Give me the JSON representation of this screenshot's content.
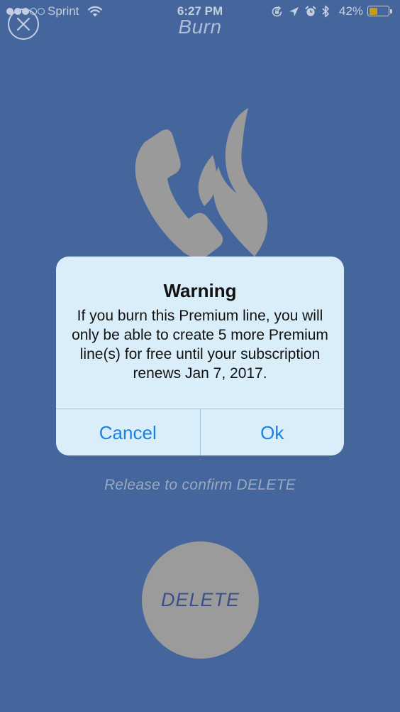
{
  "status_bar": {
    "signal_bars_filled": 3,
    "signal_bars_total": 5,
    "carrier": "Sprint",
    "time": "6:27 PM",
    "battery_percent": "42%",
    "battery_level": 0.42,
    "battery_color": "#c79c12",
    "icons": [
      "wifi-icon",
      "orientation-lock-icon",
      "location-icon",
      "alarm-icon",
      "bluetooth-icon"
    ]
  },
  "header": {
    "title": "Burn",
    "close_icon": "close-icon"
  },
  "illustration": {
    "icon": "burn-phone-flame-icon"
  },
  "alert": {
    "title": "Warning",
    "message": "If you burn this Premium line, you will only be able to create 5 more Premium line(s) for free until your subscription renews Jan 7, 2017.",
    "cancel_label": "Cancel",
    "ok_label": "Ok",
    "button_color": "#1a7fe6"
  },
  "footer": {
    "hint": "Release to confirm DELETE",
    "delete_label": "DELETE"
  },
  "colors": {
    "background": "#44669c",
    "alert_background": "#d9eef9",
    "delete_button": "#9b9b9b"
  }
}
